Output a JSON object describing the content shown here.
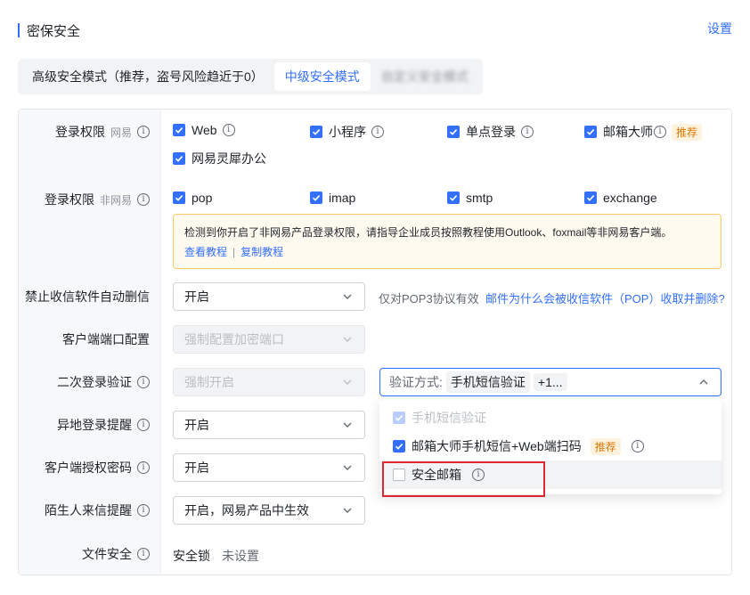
{
  "header": {
    "title": "密保安全",
    "settings_link": "设置"
  },
  "mode_tabs": [
    {
      "label": "高级安全模式（推荐，盗号风险趋近于0）",
      "state": "default"
    },
    {
      "label": "中级安全模式",
      "state": "active"
    },
    {
      "label": "自定义安全模式",
      "state": "blurred"
    }
  ],
  "rows": {
    "login_netease": {
      "label": "登录权限",
      "sub": "网易",
      "options": [
        {
          "label": "Web",
          "info": true,
          "checked": true
        },
        {
          "label": "小程序",
          "info": true,
          "checked": true
        },
        {
          "label": "单点登录",
          "info": true,
          "checked": true
        },
        {
          "label": "邮箱大师",
          "info": true,
          "checked": true,
          "tag": "推荐"
        },
        {
          "label": "网易灵犀办公",
          "info": false,
          "checked": true
        }
      ]
    },
    "login_non_netease": {
      "label": "登录权限",
      "sub": "非网易",
      "options": [
        {
          "label": "pop",
          "checked": true
        },
        {
          "label": "imap",
          "checked": true
        },
        {
          "label": "smtp",
          "checked": true
        },
        {
          "label": "exchange",
          "checked": true
        }
      ],
      "notice": {
        "text": "检测到你开启了非网易产品登录权限，请指导企业成员按照教程使用Outlook、foxmail等非网易客户端。",
        "link_view": "查看教程",
        "separator": "|",
        "link_copy": "复制教程"
      }
    },
    "pop_delete": {
      "label": "禁止收信软件自动删信",
      "value": "开启",
      "hint": "仅对POP3协议有效",
      "link": "邮件为什么会被收信软件（POP）收取并删除?"
    },
    "client_port": {
      "label": "客户端端口配置",
      "placeholder": "强制配置加密端口"
    },
    "second_verify": {
      "label": "二次登录验证",
      "placeholder": "强制开启",
      "method_prefix": "验证方式:",
      "method_chip": "手机短信验证",
      "method_more": "+1...",
      "dropdown": [
        {
          "label": "手机短信验证",
          "checked": true,
          "disabled": true
        },
        {
          "label": "邮箱大师手机短信+Web端扫码",
          "checked": true,
          "tag": "推荐",
          "info": true
        },
        {
          "label": "安全邮箱",
          "checked": false,
          "info": true
        }
      ]
    },
    "remote_login": {
      "label": "异地登录提醒",
      "value": "开启"
    },
    "client_password": {
      "label": "客户端授权密码",
      "value": "开启"
    },
    "stranger_mail": {
      "label": "陌生人来信提醒",
      "value": "开启，网易产品中生效"
    },
    "file_security": {
      "label": "文件安全",
      "item": "安全锁",
      "status": "未设置"
    }
  },
  "colors": {
    "accent": "#3370ff",
    "recommend_tag": "#de7802",
    "highlight_box": "#e0262f"
  }
}
